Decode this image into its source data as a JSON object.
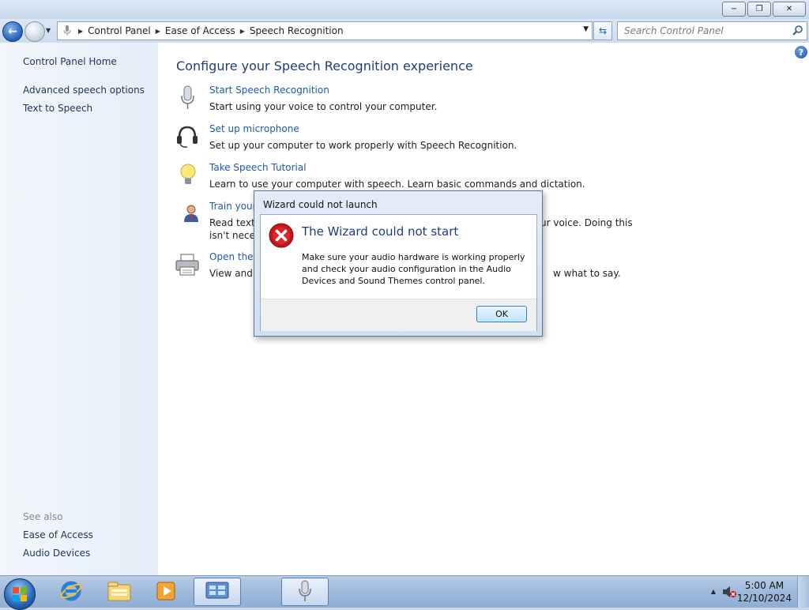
{
  "window": {
    "caption_minimize": "−",
    "caption_restore": "❐",
    "caption_close": "✕"
  },
  "address": {
    "breadcrumbs": [
      "Control Panel",
      "Ease of Access",
      "Speech Recognition"
    ],
    "search_placeholder": "Search Control Panel"
  },
  "sidebar": {
    "home": "Control Panel Home",
    "links": [
      "Advanced speech options",
      "Text to Speech"
    ],
    "see_also_label": "See also",
    "see_also": [
      "Ease of Access",
      "Audio Devices"
    ]
  },
  "main": {
    "title": "Configure your Speech Recognition experience",
    "tasks": [
      {
        "link": "Start Speech Recognition",
        "desc": "Start using your voice to control your computer.",
        "icon": "microphone-icon"
      },
      {
        "link": "Set up microphone",
        "desc": "Set up your computer to work properly with Speech Recognition.",
        "icon": "headset-icon"
      },
      {
        "link": "Take Speech Tutorial",
        "desc": "Learn to use your computer with speech.  Learn basic commands and dictation.",
        "icon": "lightbulb-icon"
      },
      {
        "link": "Train your",
        "desc": "Read text t",
        "desc_tail": "ur voice.  Doing this",
        "desc2": "isn't neces",
        "icon": "user-icon"
      },
      {
        "link": "Open the S",
        "desc": "View and p",
        "desc_tail": "w what to say.",
        "icon": "printer-icon"
      }
    ]
  },
  "dialog": {
    "title": "Wizard could not launch",
    "heading": "The Wizard could not start",
    "message": "Make sure your audio hardware is working properly and check your audio configuration in the Audio Devices and Sound Themes control panel.",
    "ok_label": "OK",
    "icon": "error-icon"
  },
  "taskbar": {
    "items": [
      "internet-explorer-icon",
      "file-explorer-icon",
      "media-player-icon",
      "control-panel-icon",
      "speech-recognition-icon"
    ],
    "time": "5:00 AM",
    "date": "12/10/2024",
    "tray_icons": [
      "show-hidden-icons-arrow",
      "volume-muted-icon"
    ]
  },
  "colors": {
    "link": "#1e5aa6",
    "title": "#1e3e79",
    "error_red": "#c4161c",
    "taskbar": "#9fb9da"
  }
}
